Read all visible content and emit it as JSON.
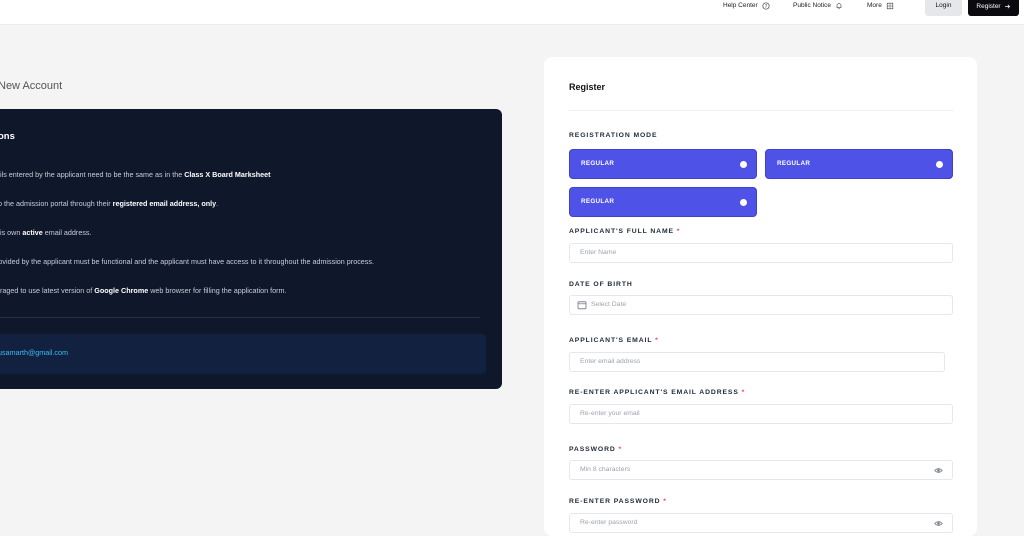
{
  "header": {
    "help_center": "Help Center",
    "public_notice": "Public Notice",
    "more": "More",
    "login": "Login",
    "register": "Register"
  },
  "page": {
    "heading": "New Account"
  },
  "info": {
    "title": "ons",
    "lines": [
      {
        "pre": "ails entered by the applicant need to be the same as in the ",
        "bold": "Class X Board Marksheet",
        "post": ""
      },
      {
        "pre": " to the admission portal through their ",
        "bold": "registered email address, only",
        "post": "."
      },
      {
        "pre": "his own ",
        "bold": "active",
        "post": " email address."
      },
      {
        "pre": "rovided by the applicant must be functional and the applicant must have access to it throughout the admission process.",
        "bold": "",
        "post": ""
      },
      {
        "pre": "uraged to use latest version of ",
        "bold": "Google Chrome",
        "post": " web browser for filling the application form."
      }
    ],
    "contact_email": "usamarth@gmail.com"
  },
  "form": {
    "title": "Register",
    "registration_mode_label": "REGISTRATION MODE",
    "modes": [
      "REGULAR",
      "REGULAR",
      "REGULAR"
    ],
    "full_name_label": "APPLICANT'S FULL NAME",
    "full_name_placeholder": "Enter Name",
    "dob_label": "DATE OF BIRTH",
    "dob_placeholder": "Select Date",
    "email_label": "APPLICANT'S EMAIL",
    "email_placeholder": "Enter email address",
    "reemail_label": "RE-ENTER APPLICANT'S EMAIL ADDRESS",
    "reemail_placeholder": "Re-enter your email",
    "password_label": "PASSWORD",
    "password_placeholder": "Min 8 characters",
    "repassword_label": "RE-ENTER PASSWORD",
    "repassword_placeholder": "Re-enter password",
    "required_mark": "*"
  },
  "colors": {
    "accent": "#4f52e6",
    "info_card_bg": "#0f172a",
    "required": "#ef4444",
    "contact_link": "#38bdf8"
  },
  "icons": {
    "help": "question-circle-icon",
    "notice": "bell-icon",
    "more": "grid-icon",
    "register_arrow": "arrow-right-icon",
    "calendar": "calendar-icon",
    "password_visibility": "eye-icon"
  }
}
